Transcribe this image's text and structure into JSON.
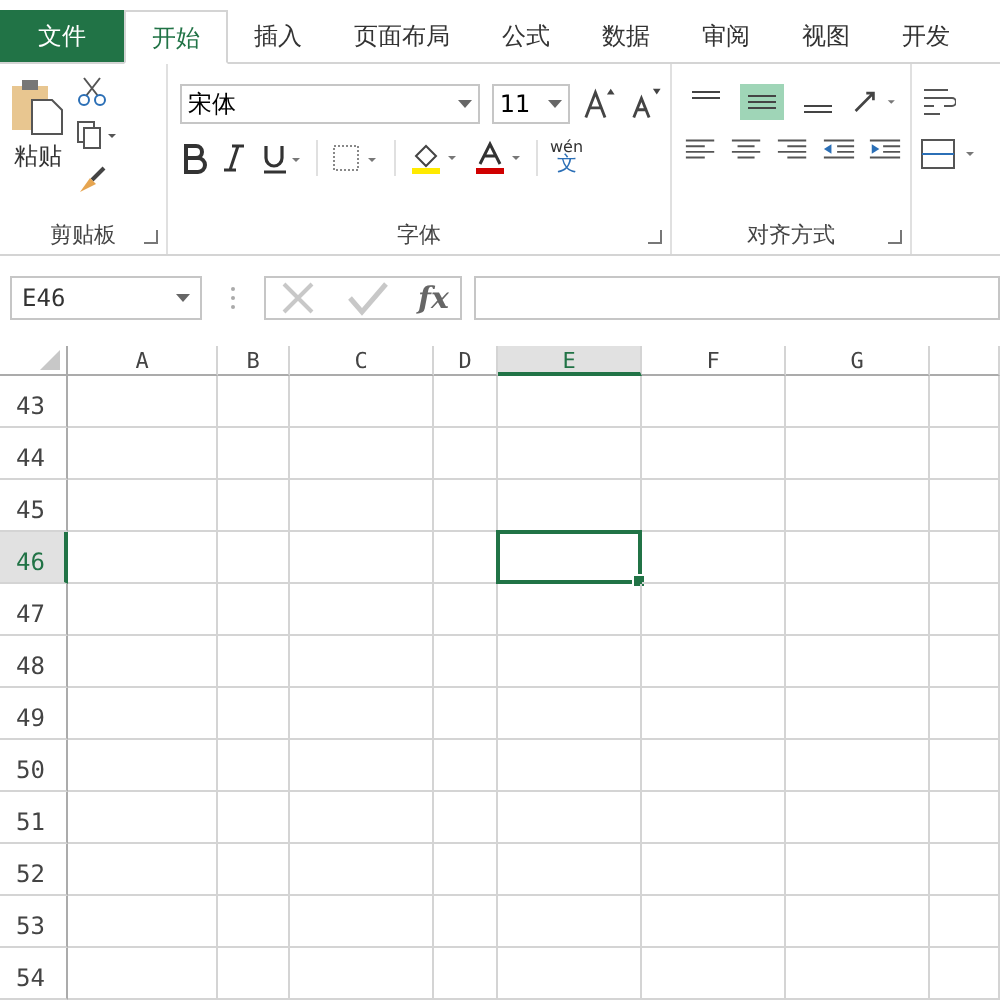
{
  "tabs": [
    {
      "label": "文件",
      "kind": "file",
      "selected": false
    },
    {
      "label": "开始",
      "kind": "tab",
      "selected": true
    },
    {
      "label": "插入",
      "kind": "tab",
      "selected": false
    },
    {
      "label": "页面布局",
      "kind": "tab",
      "selected": false
    },
    {
      "label": "公式",
      "kind": "tab",
      "selected": false
    },
    {
      "label": "数据",
      "kind": "tab",
      "selected": false
    },
    {
      "label": "审阅",
      "kind": "tab",
      "selected": false
    },
    {
      "label": "视图",
      "kind": "tab",
      "selected": false
    },
    {
      "label": "开发",
      "kind": "tab",
      "selected": false
    }
  ],
  "clipboard": {
    "paste_label": "粘贴",
    "group_label": "剪贴板"
  },
  "font": {
    "name": "宋体",
    "size": "11",
    "phonetic": "wén",
    "phonetic_char": "文",
    "group_label": "字体"
  },
  "alignment": {
    "vertical": [
      {
        "selected": false
      },
      {
        "selected": true
      },
      {
        "selected": false
      }
    ],
    "group_label": "对齐方式"
  },
  "formula_bar": {
    "name_box": "E46",
    "fx": "fx"
  },
  "columns": [
    {
      "label": "A",
      "selected": false
    },
    {
      "label": "B",
      "selected": false
    },
    {
      "label": "C",
      "selected": false
    },
    {
      "label": "D",
      "selected": false
    },
    {
      "label": "E",
      "selected": true
    },
    {
      "label": "F",
      "selected": false
    },
    {
      "label": "G",
      "selected": false
    }
  ],
  "rows": [
    {
      "label": "43",
      "selected": false
    },
    {
      "label": "44",
      "selected": false
    },
    {
      "label": "45",
      "selected": false
    },
    {
      "label": "46",
      "selected": true
    },
    {
      "label": "47",
      "selected": false
    },
    {
      "label": "48",
      "selected": false
    },
    {
      "label": "49",
      "selected": false
    },
    {
      "label": "50",
      "selected": false
    },
    {
      "label": "51",
      "selected": false
    },
    {
      "label": "52",
      "selected": false
    },
    {
      "label": "53",
      "selected": false
    },
    {
      "label": "54",
      "selected": false
    }
  ]
}
